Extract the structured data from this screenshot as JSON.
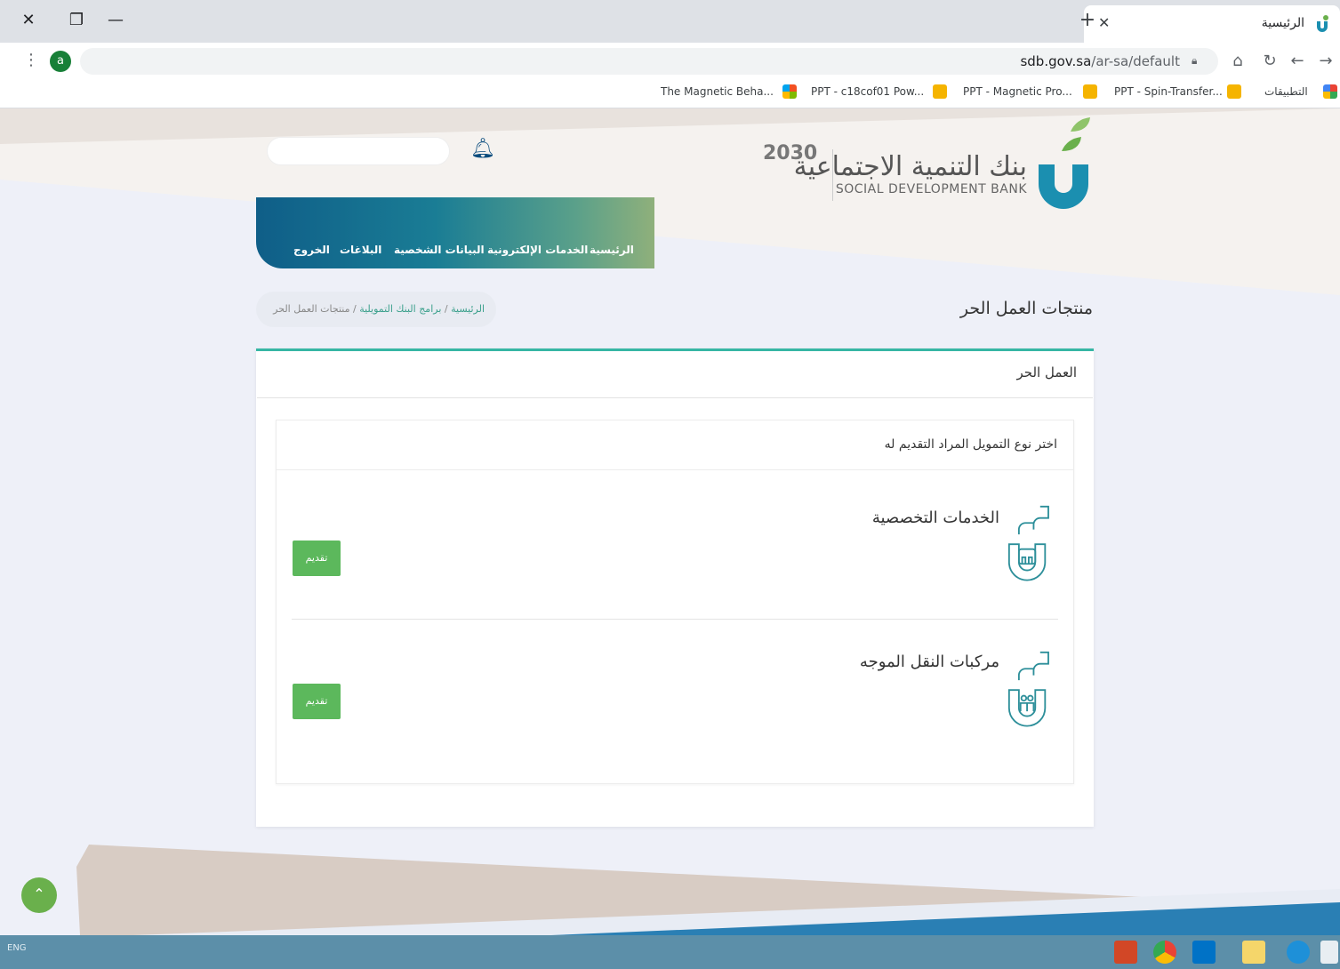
{
  "browser": {
    "tab_title": "الرئيسية",
    "url_host": "sdb.gov.sa",
    "url_path": "/ar-sa/default",
    "profile_initial": "a",
    "bookmarks": [
      {
        "label": "The Magnetic Beha..."
      },
      {
        "label": "PPT - c18cof01 Pow..."
      },
      {
        "label": "PPT - Magnetic Pro..."
      },
      {
        "label": "PPT - Spin-Transfer..."
      },
      {
        "label": "التطبيقات"
      }
    ]
  },
  "header": {
    "logo_ar": "بنك التنمية الاجتماعية",
    "logo_en": "SOCIAL DEVELOPMENT BANK",
    "vision": "2030",
    "search_placeholder": ""
  },
  "nav": {
    "items": [
      "الرئيسية",
      "الخدمات الإلكترونية",
      "البيانات الشخصية",
      "البلاغات",
      "الخروج"
    ]
  },
  "breadcrumb": {
    "home": "الرئيسية",
    "sep": "/",
    "programs": "برامج البنك التمويلية",
    "current": "منتجات العمل الحر"
  },
  "page_title": "منتجات العمل الحر",
  "card": {
    "title": "العمل الحر",
    "subtitle": "اختر نوع التمويل المراد التقديم له",
    "services": [
      {
        "name": "الخدمات التخصصية",
        "button": "تقديم",
        "icon": "specialized-services-icon"
      },
      {
        "name": "مركبات النقل الموجه",
        "button": "تقديم",
        "icon": "directed-transport-icon"
      }
    ]
  },
  "colors": {
    "accent_teal": "#36b6a4",
    "apply_green": "#5cb85c",
    "nav_blue": "#0f5e88",
    "brand_green": "#6ab04c"
  },
  "taskbar": {
    "lang": "ENG"
  }
}
